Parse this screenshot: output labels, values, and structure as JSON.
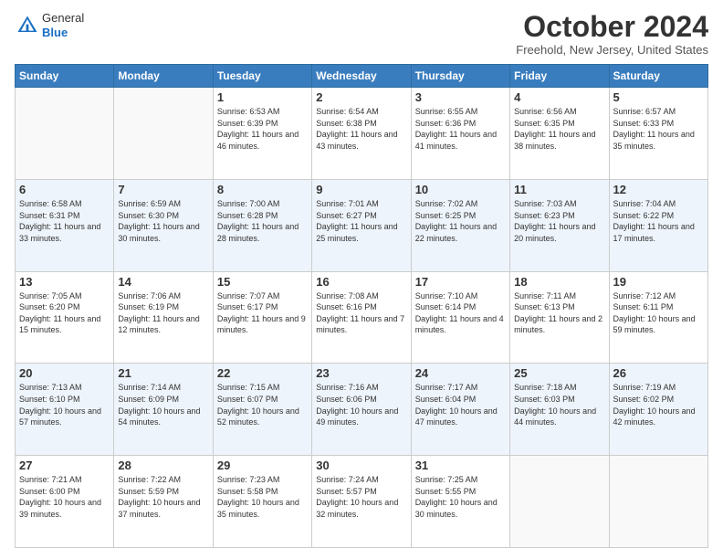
{
  "header": {
    "logo_general": "General",
    "logo_blue": "Blue",
    "month_title": "October 2024",
    "location": "Freehold, New Jersey, United States"
  },
  "days_of_week": [
    "Sunday",
    "Monday",
    "Tuesday",
    "Wednesday",
    "Thursday",
    "Friday",
    "Saturday"
  ],
  "weeks": [
    [
      {
        "day": "",
        "info": ""
      },
      {
        "day": "",
        "info": ""
      },
      {
        "day": "1",
        "info": "Sunrise: 6:53 AM\nSunset: 6:39 PM\nDaylight: 11 hours and 46 minutes."
      },
      {
        "day": "2",
        "info": "Sunrise: 6:54 AM\nSunset: 6:38 PM\nDaylight: 11 hours and 43 minutes."
      },
      {
        "day": "3",
        "info": "Sunrise: 6:55 AM\nSunset: 6:36 PM\nDaylight: 11 hours and 41 minutes."
      },
      {
        "day": "4",
        "info": "Sunrise: 6:56 AM\nSunset: 6:35 PM\nDaylight: 11 hours and 38 minutes."
      },
      {
        "day": "5",
        "info": "Sunrise: 6:57 AM\nSunset: 6:33 PM\nDaylight: 11 hours and 35 minutes."
      }
    ],
    [
      {
        "day": "6",
        "info": "Sunrise: 6:58 AM\nSunset: 6:31 PM\nDaylight: 11 hours and 33 minutes."
      },
      {
        "day": "7",
        "info": "Sunrise: 6:59 AM\nSunset: 6:30 PM\nDaylight: 11 hours and 30 minutes."
      },
      {
        "day": "8",
        "info": "Sunrise: 7:00 AM\nSunset: 6:28 PM\nDaylight: 11 hours and 28 minutes."
      },
      {
        "day": "9",
        "info": "Sunrise: 7:01 AM\nSunset: 6:27 PM\nDaylight: 11 hours and 25 minutes."
      },
      {
        "day": "10",
        "info": "Sunrise: 7:02 AM\nSunset: 6:25 PM\nDaylight: 11 hours and 22 minutes."
      },
      {
        "day": "11",
        "info": "Sunrise: 7:03 AM\nSunset: 6:23 PM\nDaylight: 11 hours and 20 minutes."
      },
      {
        "day": "12",
        "info": "Sunrise: 7:04 AM\nSunset: 6:22 PM\nDaylight: 11 hours and 17 minutes."
      }
    ],
    [
      {
        "day": "13",
        "info": "Sunrise: 7:05 AM\nSunset: 6:20 PM\nDaylight: 11 hours and 15 minutes."
      },
      {
        "day": "14",
        "info": "Sunrise: 7:06 AM\nSunset: 6:19 PM\nDaylight: 11 hours and 12 minutes."
      },
      {
        "day": "15",
        "info": "Sunrise: 7:07 AM\nSunset: 6:17 PM\nDaylight: 11 hours and 9 minutes."
      },
      {
        "day": "16",
        "info": "Sunrise: 7:08 AM\nSunset: 6:16 PM\nDaylight: 11 hours and 7 minutes."
      },
      {
        "day": "17",
        "info": "Sunrise: 7:10 AM\nSunset: 6:14 PM\nDaylight: 11 hours and 4 minutes."
      },
      {
        "day": "18",
        "info": "Sunrise: 7:11 AM\nSunset: 6:13 PM\nDaylight: 11 hours and 2 minutes."
      },
      {
        "day": "19",
        "info": "Sunrise: 7:12 AM\nSunset: 6:11 PM\nDaylight: 10 hours and 59 minutes."
      }
    ],
    [
      {
        "day": "20",
        "info": "Sunrise: 7:13 AM\nSunset: 6:10 PM\nDaylight: 10 hours and 57 minutes."
      },
      {
        "day": "21",
        "info": "Sunrise: 7:14 AM\nSunset: 6:09 PM\nDaylight: 10 hours and 54 minutes."
      },
      {
        "day": "22",
        "info": "Sunrise: 7:15 AM\nSunset: 6:07 PM\nDaylight: 10 hours and 52 minutes."
      },
      {
        "day": "23",
        "info": "Sunrise: 7:16 AM\nSunset: 6:06 PM\nDaylight: 10 hours and 49 minutes."
      },
      {
        "day": "24",
        "info": "Sunrise: 7:17 AM\nSunset: 6:04 PM\nDaylight: 10 hours and 47 minutes."
      },
      {
        "day": "25",
        "info": "Sunrise: 7:18 AM\nSunset: 6:03 PM\nDaylight: 10 hours and 44 minutes."
      },
      {
        "day": "26",
        "info": "Sunrise: 7:19 AM\nSunset: 6:02 PM\nDaylight: 10 hours and 42 minutes."
      }
    ],
    [
      {
        "day": "27",
        "info": "Sunrise: 7:21 AM\nSunset: 6:00 PM\nDaylight: 10 hours and 39 minutes."
      },
      {
        "day": "28",
        "info": "Sunrise: 7:22 AM\nSunset: 5:59 PM\nDaylight: 10 hours and 37 minutes."
      },
      {
        "day": "29",
        "info": "Sunrise: 7:23 AM\nSunset: 5:58 PM\nDaylight: 10 hours and 35 minutes."
      },
      {
        "day": "30",
        "info": "Sunrise: 7:24 AM\nSunset: 5:57 PM\nDaylight: 10 hours and 32 minutes."
      },
      {
        "day": "31",
        "info": "Sunrise: 7:25 AM\nSunset: 5:55 PM\nDaylight: 10 hours and 30 minutes."
      },
      {
        "day": "",
        "info": ""
      },
      {
        "day": "",
        "info": ""
      }
    ]
  ]
}
